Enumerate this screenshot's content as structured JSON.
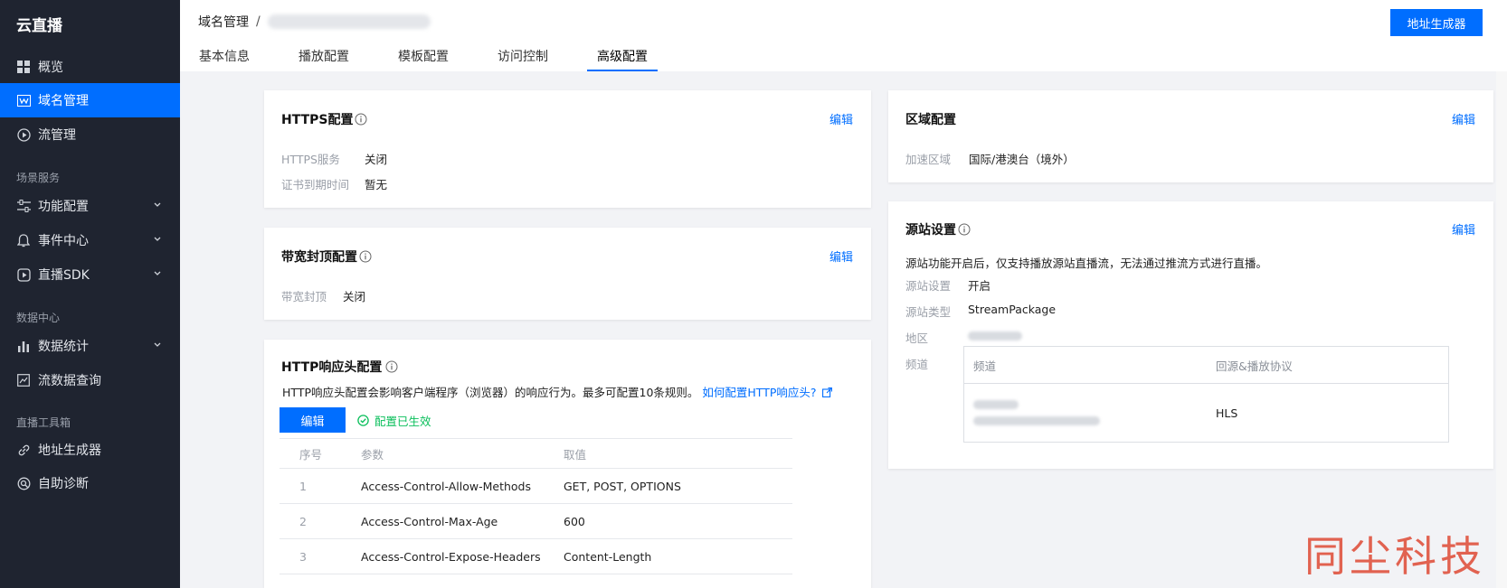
{
  "sidebar": {
    "title": "云直播",
    "items": [
      {
        "label": "概览",
        "icon": "grid-icon"
      },
      {
        "label": "域名管理",
        "icon": "domain-icon",
        "active": true
      },
      {
        "label": "流管理",
        "icon": "play-circle-icon"
      }
    ],
    "sections": [
      {
        "label": "场景服务",
        "items": [
          {
            "label": "功能配置",
            "icon": "sliders-icon",
            "expandable": true
          },
          {
            "label": "事件中心",
            "icon": "bell-icon",
            "expandable": true
          },
          {
            "label": "直播SDK",
            "icon": "play-icon",
            "expandable": true
          }
        ]
      },
      {
        "label": "数据中心",
        "items": [
          {
            "label": "数据统计",
            "icon": "bar-chart-icon",
            "expandable": true
          },
          {
            "label": "流数据查询",
            "icon": "line-chart-icon"
          }
        ]
      },
      {
        "label": "直播工具箱",
        "items": [
          {
            "label": "地址生成器",
            "icon": "link-icon"
          },
          {
            "label": "自助诊断",
            "icon": "diagnose-icon"
          }
        ]
      }
    ]
  },
  "header": {
    "breadcrumb_root": "域名管理",
    "breadcrumb_sep": "/",
    "generator_button": "地址生成器",
    "tabs": [
      {
        "label": "基本信息"
      },
      {
        "label": "播放配置"
      },
      {
        "label": "模板配置"
      },
      {
        "label": "访问控制"
      },
      {
        "label": "高级配置",
        "active": true
      }
    ]
  },
  "https_card": {
    "title": "HTTPS配置",
    "edit": "编辑",
    "rows": [
      {
        "key": "HTTPS服务",
        "value": "关闭"
      },
      {
        "key": "证书到期时间",
        "value": "暂无"
      }
    ]
  },
  "bandwidth_card": {
    "title": "带宽封顶配置",
    "edit": "编辑",
    "rows": [
      {
        "key": "带宽封顶",
        "value": "关闭"
      }
    ]
  },
  "http_header_card": {
    "title": "HTTP响应头配置",
    "description": "HTTP响应头配置会影响客户端程序（浏览器）的响应行为。最多可配置10条规则。",
    "help_link": "如何配置HTTP响应头?",
    "edit_button": "编辑",
    "status": "配置已生效",
    "columns": [
      "序号",
      "参数",
      "取值"
    ],
    "rows": [
      {
        "idx": "1",
        "param": "Access-Control-Allow-Methods",
        "value": "GET, POST, OPTIONS"
      },
      {
        "idx": "2",
        "param": "Access-Control-Max-Age",
        "value": "600"
      },
      {
        "idx": "3",
        "param": "Access-Control-Expose-Headers",
        "value": "Content-Length"
      }
    ]
  },
  "region_card": {
    "title": "区域配置",
    "edit": "编辑",
    "rows": [
      {
        "key": "加速区域",
        "value": "国际/港澳台（境外）"
      }
    ]
  },
  "origin_card": {
    "title": "源站设置",
    "edit": "编辑",
    "notice": "源站功能开启后，仅支持播放源站直播流，无法通过推流方式进行直播。",
    "rows": [
      {
        "key": "源站设置",
        "value": "开启"
      },
      {
        "key": "源站类型",
        "value": "StreamPackage"
      },
      {
        "key": "地区",
        "value": ""
      }
    ],
    "channel_label": "频道",
    "channel_columns": [
      "频道",
      "回源&播放协议"
    ],
    "channel_protocol": "HLS"
  },
  "watermark": "同尘科技",
  "colors": {
    "accent": "#006eff",
    "sidebar_bg": "#1f2430",
    "success": "#0abf5b",
    "watermark": "#e0533f"
  }
}
